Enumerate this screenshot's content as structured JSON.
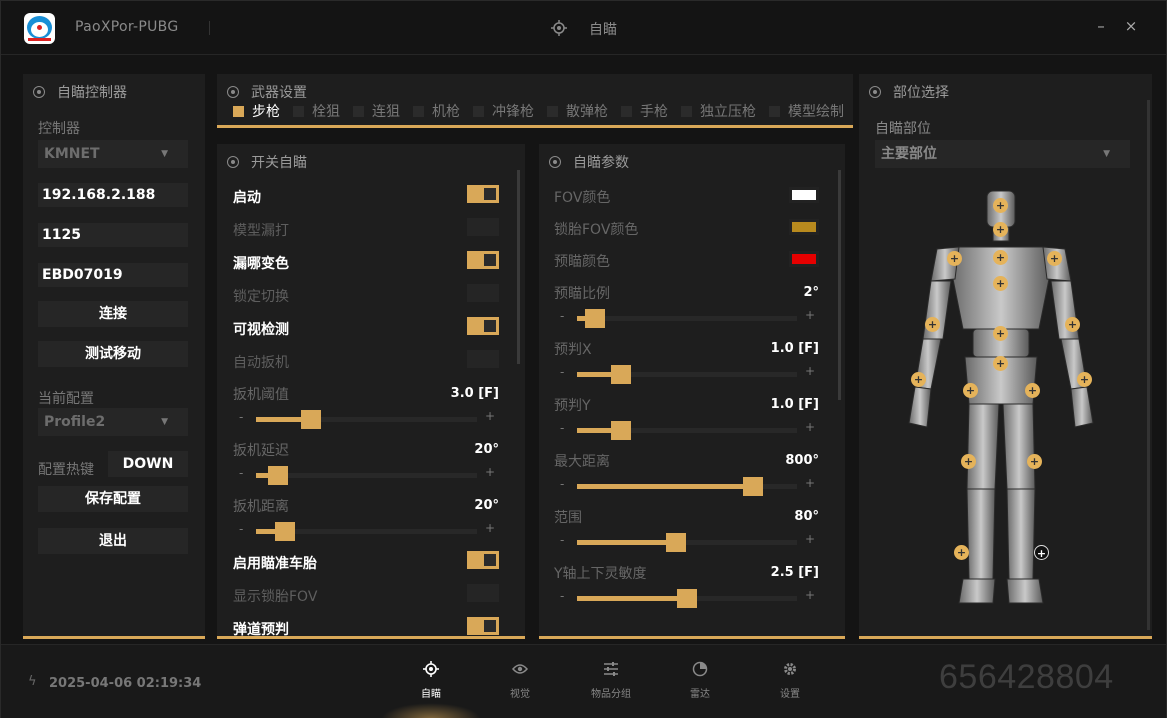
{
  "app": {
    "title": "PaoXPor-PUBG",
    "section_title": "自瞄",
    "minimize_symbol": "–",
    "close_symbol": "×"
  },
  "colors": {
    "accent": "#d9a858",
    "fov_color": "#ffffff",
    "lock_fov_color": "#b88a1e",
    "pre_aim_color": "#e60000"
  },
  "controller_panel": {
    "header": "自瞄控制器",
    "controller_label": "控制器",
    "controller_value": "KMNET",
    "ip_value": "192.168.2.188",
    "port_value": "1125",
    "uuid_value": "EBD07019",
    "connect_label": "连接",
    "test_move_label": "测试移动",
    "current_config_label": "当前配置",
    "current_config_value": "Profile2",
    "hotkey_label": "配置热键",
    "hotkey_value": "DOWN",
    "save_config_label": "保存配置",
    "exit_label": "退出"
  },
  "weapon_panel": {
    "header": "武器设置",
    "tabs": [
      {
        "label": "步枪",
        "active": true
      },
      {
        "label": "栓狙",
        "active": false
      },
      {
        "label": "连狙",
        "active": false
      },
      {
        "label": "机枪",
        "active": false
      },
      {
        "label": "冲锋枪",
        "active": false
      },
      {
        "label": "散弹枪",
        "active": false
      },
      {
        "label": "手枪",
        "active": false
      },
      {
        "label": "独立压枪",
        "active": false
      },
      {
        "label": "模型绘制",
        "active": false
      }
    ]
  },
  "switch_panel": {
    "header": "开关自瞄",
    "toggles": [
      {
        "label": "启动",
        "on": true
      },
      {
        "label": "模型漏打",
        "on": false
      },
      {
        "label": "漏哪变色",
        "on": true
      },
      {
        "label": "锁定切换",
        "on": false
      },
      {
        "label": "可视检测",
        "on": true
      },
      {
        "label": "自动扳机",
        "on": false
      }
    ],
    "sliders": [
      {
        "label": "扳机阈值",
        "value": "3.0 [F]",
        "fraction": 0.25
      },
      {
        "label": "扳机延迟",
        "value": "20°",
        "fraction": 0.1
      },
      {
        "label": "扳机距离",
        "value": "20°",
        "fraction": 0.13
      }
    ],
    "toggles2": [
      {
        "label": "启用瞄准车胎",
        "on": true
      },
      {
        "label": "显示锁胎FOV",
        "on": false
      },
      {
        "label": "弹道预判",
        "on": true
      }
    ]
  },
  "params_panel": {
    "header": "自瞄参数",
    "fov_color_label": "FOV颜色",
    "lock_fov_color_label": "锁胎FOV颜色",
    "pre_aim_color_label": "预瞄颜色",
    "sliders": [
      {
        "label": "预瞄比例",
        "value": "2°",
        "fraction": 0.08
      },
      {
        "label": "预判X",
        "value": "1.0 [F]",
        "fraction": 0.2
      },
      {
        "label": "预判Y",
        "value": "1.0 [F]",
        "fraction": 0.2
      },
      {
        "label": "最大距离",
        "value": "800°",
        "fraction": 0.8
      },
      {
        "label": "范围",
        "value": "80°",
        "fraction": 0.45
      },
      {
        "label": "Y轴上下灵敏度",
        "value": "2.5 [F]",
        "fraction": 0.5
      }
    ]
  },
  "body_panel": {
    "header": "部位选择",
    "aim_part_label": "自瞄部位",
    "aim_part_value": "主要部位"
  },
  "statusbar": {
    "datetime": "2025-04-06 02:19:34",
    "qq": "656428804",
    "nav": [
      {
        "label": "自瞄",
        "icon": "crosshair-icon",
        "active": true
      },
      {
        "label": "视觉",
        "icon": "eye-icon",
        "active": false
      },
      {
        "label": "物品分组",
        "icon": "sliders-icon",
        "active": false
      },
      {
        "label": "雷达",
        "icon": "radar-icon",
        "active": false
      },
      {
        "label": "设置",
        "icon": "gear-icon",
        "active": false
      }
    ]
  }
}
